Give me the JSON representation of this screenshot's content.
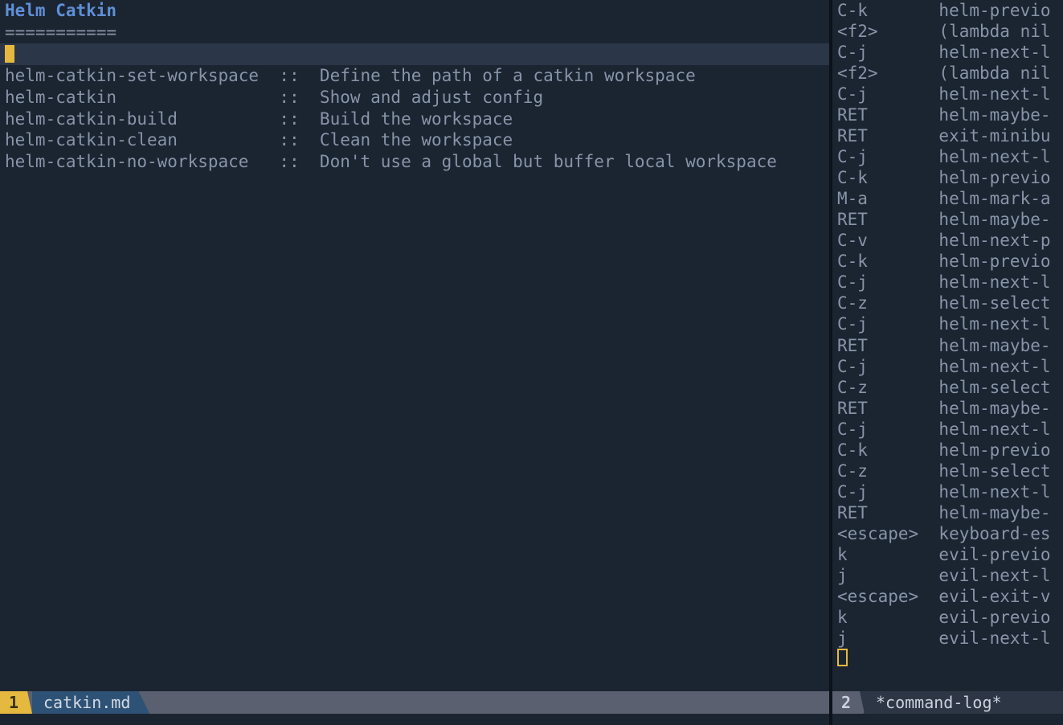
{
  "header": {
    "title": "Helm Catkin",
    "underline": "==========="
  },
  "commands": [
    {
      "name": "helm-catkin-set-workspace",
      "desc": "Define the path of a catkin workspace"
    },
    {
      "name": "helm-catkin",
      "desc": "Show and adjust config"
    },
    {
      "name": "helm-catkin-build",
      "desc": "Build the workspace"
    },
    {
      "name": "helm-catkin-clean",
      "desc": "Clean the workspace"
    },
    {
      "name": "helm-catkin-no-workspace",
      "desc": "Don't use a global but buffer local workspace"
    }
  ],
  "log": [
    {
      "key": "C-k",
      "cmd": "helm-previo"
    },
    {
      "key": "<f2>",
      "cmd": "(lambda nil"
    },
    {
      "key": "C-j",
      "cmd": "helm-next-l"
    },
    {
      "key": "<f2>",
      "cmd": "(lambda nil"
    },
    {
      "key": "C-j",
      "cmd": "helm-next-l"
    },
    {
      "key": "RET",
      "cmd": "helm-maybe-"
    },
    {
      "key": "RET",
      "cmd": "exit-minibu"
    },
    {
      "key": "C-j",
      "cmd": "helm-next-l"
    },
    {
      "key": "C-k",
      "cmd": "helm-previo"
    },
    {
      "key": "M-a",
      "cmd": "helm-mark-a"
    },
    {
      "key": "RET",
      "cmd": "helm-maybe-"
    },
    {
      "key": "C-v",
      "cmd": "helm-next-p"
    },
    {
      "key": "C-k",
      "cmd": "helm-previo"
    },
    {
      "key": "C-j",
      "cmd": "helm-next-l"
    },
    {
      "key": "C-z",
      "cmd": "helm-select"
    },
    {
      "key": "C-j",
      "cmd": "helm-next-l"
    },
    {
      "key": "RET",
      "cmd": "helm-maybe-"
    },
    {
      "key": "C-j",
      "cmd": "helm-next-l"
    },
    {
      "key": "C-z",
      "cmd": "helm-select"
    },
    {
      "key": "RET",
      "cmd": "helm-maybe-"
    },
    {
      "key": "C-j",
      "cmd": "helm-next-l"
    },
    {
      "key": "C-k",
      "cmd": "helm-previo"
    },
    {
      "key": "C-z",
      "cmd": "helm-select"
    },
    {
      "key": "C-j",
      "cmd": "helm-next-l"
    },
    {
      "key": "RET",
      "cmd": "helm-maybe-"
    },
    {
      "key": "<escape>",
      "cmd": "keyboard-es"
    },
    {
      "key": "k",
      "cmd": "evil-previo"
    },
    {
      "key": "j",
      "cmd": "evil-next-l"
    },
    {
      "key": "<escape>",
      "cmd": "evil-exit-v"
    },
    {
      "key": "k",
      "cmd": "evil-previo"
    },
    {
      "key": "j",
      "cmd": "evil-next-l"
    }
  ],
  "modeline": {
    "left": {
      "num": "1",
      "buffer": "catkin.md"
    },
    "right": {
      "num": "2",
      "buffer": "*command-log*"
    }
  }
}
